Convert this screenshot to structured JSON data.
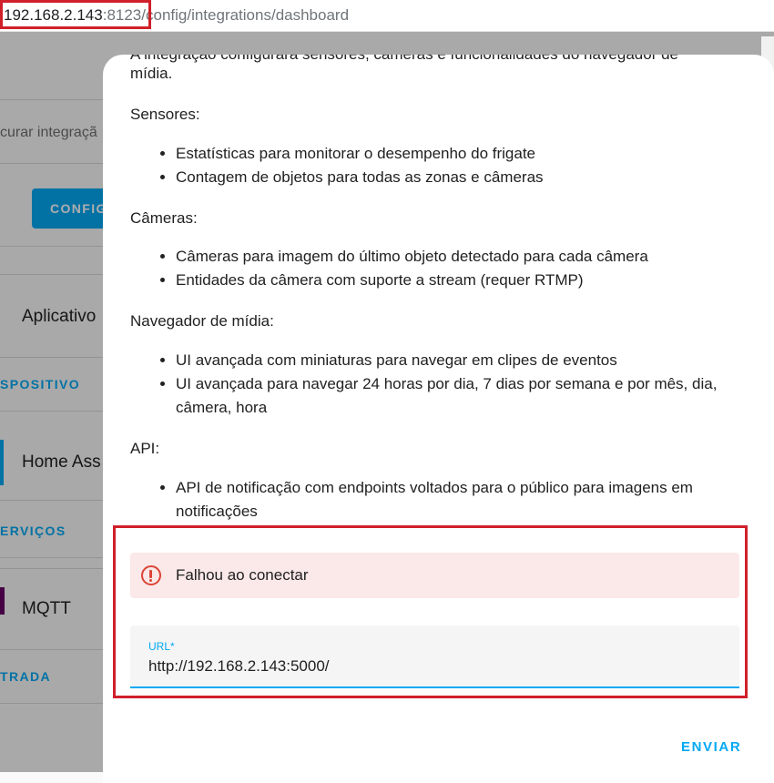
{
  "browser": {
    "url_host": "192.168.2.143",
    "url_port": ":8123",
    "url_path": "/config/integrations/dashboard"
  },
  "background": {
    "search_placeholder": "curar integraçã",
    "config_button": "CONFIG",
    "card1_title": "Aplicativo",
    "section1": "SPOSITIVO",
    "card2_title": "Home Ass",
    "section2": "ERVIÇOS",
    "card3_title": "MQTT",
    "section3": "TRADA"
  },
  "dialog": {
    "clipped_intro": "A integração configurará sensores, câmeras e funcionalidades do navegador de",
    "intro_tail": "mídia.",
    "sensors_heading": "Sensores:",
    "sensors_items": [
      "Estatísticas para monitorar o desempenho do frigate",
      "Contagem de objetos para todas as zonas e câmeras"
    ],
    "cameras_heading": "Câmeras:",
    "cameras_items": [
      "Câmeras para imagem do último objeto detectado para cada câmera",
      "Entidades da câmera com suporte a stream (requer RTMP)"
    ],
    "media_heading": "Navegador de mídia:",
    "media_items": [
      "UI avançada com miniaturas para navegar em clipes de eventos",
      "UI avançada para navegar 24 horas por dia, 7 dias por semana e por mês, dia, câmera, hora"
    ],
    "api_heading": "API:",
    "api_items": [
      "API de notificação com endpoints voltados para o público para imagens em notificações"
    ],
    "error_text": "Falhou ao conectar",
    "url_label": "URL*",
    "url_value": "http://192.168.2.143:5000/",
    "submit_label": "ENVIAR"
  },
  "colors": {
    "accent": "#03a9f4",
    "error": "#db4437",
    "error_bg": "#fbe8e8",
    "highlight": "#d0202a"
  }
}
